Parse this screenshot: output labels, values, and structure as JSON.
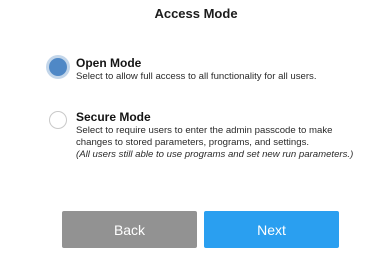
{
  "title": "Access Mode",
  "options": [
    {
      "label": "Open Mode",
      "description": "Select to allow full access to all functionality for all users.",
      "selected": true
    },
    {
      "label": "Secure Mode",
      "description_line1": "Select to require users to enter the admin passcode to make",
      "description_line2": "changes to stored parameters, programs, and settings.",
      "note": "(All users still able to use programs and set new run parameters.)",
      "selected": false
    }
  ],
  "buttons": {
    "back": "Back",
    "next": "Next"
  },
  "colors": {
    "radio_selected": "#4f88c6",
    "back_button": "#929292",
    "next_button": "#2a9ff0"
  }
}
